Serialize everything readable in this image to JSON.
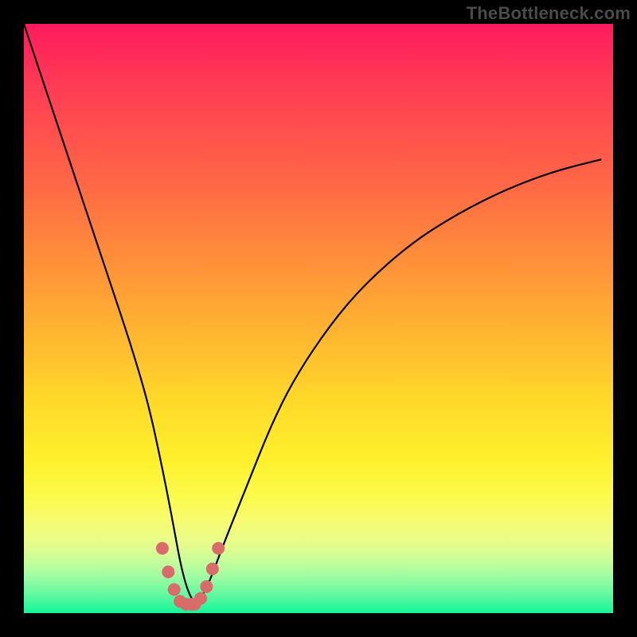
{
  "watermark": "TheBottleneck.com",
  "colors": {
    "frame": "#000000",
    "curve": "#000000",
    "dip_marker": "#d96b6b",
    "gradient_stops": [
      "#ff1a5e",
      "#ff3a55",
      "#ff6a45",
      "#ff8f3a",
      "#ffb431",
      "#ffd92a",
      "#fff02c",
      "#fbfb4a",
      "#f7fb6e",
      "#e9fc8a",
      "#c9fd9a",
      "#9cfca3",
      "#5ef9a0",
      "#14f59a"
    ]
  },
  "chart_data": {
    "type": "line",
    "title": "",
    "xlabel": "",
    "ylabel": "",
    "xlim": [
      0,
      100
    ],
    "ylim": [
      0,
      100
    ],
    "note": "No axis ticks or numeric labels are visible in the image; x is a normalized 0–100 horizontal position, y is a normalized 0–100 vertical value where 0 is the bottom (green) and 100 is the top (red). Values are estimated from pixel positions.",
    "series": [
      {
        "name": "curve",
        "x": [
          0,
          3,
          6,
          9,
          12,
          15,
          18,
          21,
          23,
          25,
          27,
          29,
          31,
          34,
          38,
          42,
          46,
          52,
          58,
          66,
          74,
          82,
          90,
          98
        ],
        "y": [
          100,
          91,
          82,
          73,
          64,
          55,
          46,
          36,
          27,
          17,
          6,
          1,
          4,
          12,
          22,
          32,
          40,
          49,
          56,
          63,
          68,
          72,
          75,
          77
        ]
      },
      {
        "name": "dip-marker",
        "x": [
          23.5,
          24.5,
          25.5,
          26.5,
          27.5,
          28.5,
          29.0,
          30.0,
          31.0,
          32.0,
          33.0
        ],
        "y": [
          11.0,
          7.0,
          4.0,
          2.0,
          1.5,
          1.5,
          1.5,
          2.5,
          4.5,
          7.5,
          11.0
        ]
      }
    ],
    "minimum": {
      "x": 28.5,
      "y": 1.5
    }
  }
}
